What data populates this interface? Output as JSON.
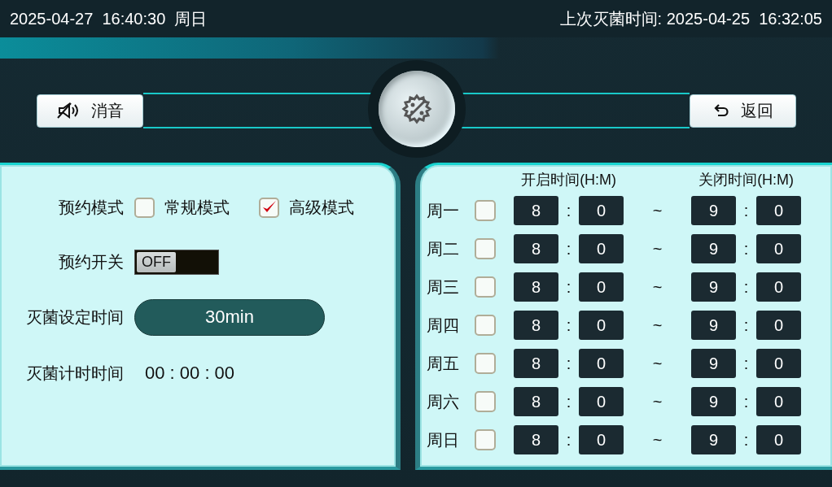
{
  "status_bar": {
    "current_time": "2025-04-27  16:40:30  周日",
    "last_sterilization": "上次灭菌时间: 2025-04-25  16:32:05"
  },
  "header": {
    "mute_button": {
      "label": "消音"
    },
    "back_button": {
      "label": "返回"
    }
  },
  "settings": {
    "mode": {
      "label": "预约模式",
      "options": [
        {
          "label": "常规模式",
          "checked": false
        },
        {
          "label": "高级模式",
          "checked": true
        }
      ]
    },
    "switch": {
      "label": "预约开关",
      "on": false,
      "text": "OFF"
    },
    "duration": {
      "label": "灭菌设定时间",
      "value": "30min"
    },
    "timer": {
      "label": "灭菌计时时间",
      "value": "00 : 00 : 00"
    }
  },
  "schedule": {
    "start_header": "开启时间(H:M)",
    "end_header": "关闭时间(H:M)",
    "rows": [
      {
        "day": "周一",
        "checked": false,
        "start_hour": "8",
        "start_sep": ":",
        "start_minute": "0",
        "range_sep": "~",
        "end_hour": "9",
        "end_sep": ":",
        "end_minute": "0"
      },
      {
        "day": "周二",
        "checked": false,
        "start_hour": "8",
        "start_sep": ":",
        "start_minute": "0",
        "range_sep": "~",
        "end_hour": "9",
        "end_sep": ":",
        "end_minute": "0"
      },
      {
        "day": "周三",
        "checked": false,
        "start_hour": "8",
        "start_sep": ":",
        "start_minute": "0",
        "range_sep": "~",
        "end_hour": "9",
        "end_sep": ":",
        "end_minute": "0"
      },
      {
        "day": "周四",
        "checked": false,
        "start_hour": "8",
        "start_sep": ":",
        "start_minute": "0",
        "range_sep": "~",
        "end_hour": "9",
        "end_sep": ":",
        "end_minute": "0"
      },
      {
        "day": "周五",
        "checked": false,
        "start_hour": "8",
        "start_sep": ":",
        "start_minute": "0",
        "range_sep": "~",
        "end_hour": "9",
        "end_sep": ":",
        "end_minute": "0"
      },
      {
        "day": "周六",
        "checked": false,
        "start_hour": "8",
        "start_sep": ":",
        "start_minute": "0",
        "range_sep": "~",
        "end_hour": "9",
        "end_sep": ":",
        "end_minute": "0"
      },
      {
        "day": "周日",
        "checked": false,
        "start_hour": "8",
        "start_sep": ":",
        "start_minute": "0",
        "range_sep": "~",
        "end_hour": "9",
        "end_sep": ":",
        "end_minute": "0"
      }
    ]
  }
}
